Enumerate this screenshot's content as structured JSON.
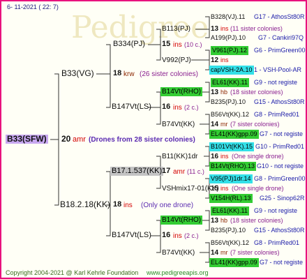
{
  "header": {
    "date_text": "6- 11-2021 ( 22: 7)"
  },
  "footer": {
    "copyright": "Copyright 2004-2021 @ Karl Kehrle Foundation",
    "site": "www.pedigreeapis.org"
  },
  "tree": {
    "root": {
      "label": "B33(SFW)",
      "gen_num": "20",
      "gen_code": "amr",
      "note": "(Drones from 28 sister colonies)"
    },
    "a": {
      "label": "B33(VG)",
      "gen_num": "18",
      "gen_code": "krw",
      "note": "(26 sister colonies)"
    },
    "a1": {
      "label": "B334(PJ)",
      "gen_num": "15",
      "gen_code": "ins",
      "note": "(10 c.)"
    },
    "a1a": {
      "label": "B113(PJ)",
      "gen_num": "13",
      "gen_code": "ins",
      "note": "(11 sister colonies)"
    },
    "a1a_f": {
      "label": "B328(VJ).11",
      "extra": "G17 - AthosSt80R"
    },
    "a1a_m": {
      "label": "A199(PJ).10",
      "extra": "G7 - Cankiri97Q"
    },
    "a1b": {
      "label": "V992(PJ)",
      "gen_num": "12",
      "gen_code": "ins"
    },
    "a1b_f": {
      "label": "V961(PJ).12",
      "extra": "G6 - PrimGreen00"
    },
    "a1b_m": {
      "label": "capVSH-2A.10",
      "extra": "1 - VSH-Pool-AR"
    },
    "a2": {
      "label": "B147Vt(LS)",
      "gen_num": "16",
      "gen_code": "ins",
      "note": "(2 c.)"
    },
    "a2a": {
      "label": "B14Vt(RHO)",
      "gen_num": "13",
      "gen_code": "hb",
      "note": "(18 sister colonies)"
    },
    "a2a_f": {
      "label": "EL61(KK).11",
      "extra": "G9 - not registe"
    },
    "a2a_m": {
      "label": "B235(PJ).10",
      "extra": "G15 - AthosSt80R"
    },
    "a2b": {
      "label": "B74Vt(KK)",
      "gen_num": "14",
      "gen_code": "mr",
      "note": "(7 sister colonies)"
    },
    "a2b_f": {
      "label": "B56Vt(KK).12",
      "extra": "G8 - PrimRed01"
    },
    "a2b_m": {
      "label": "EL41(KK)gpp.09",
      "extra": "G7 - not registe"
    },
    "b": {
      "label": "B18.2.18(KK)",
      "gen_num": "18",
      "gen_code": "ins",
      "note": "(Only one drone)"
    },
    "b1": {
      "label": "B17.1.537(KK)",
      "gen_num": "17",
      "gen_code": "amr",
      "note": "(11 c.)"
    },
    "b1a": {
      "label": "B11(KK)1dr",
      "gen_num": "16",
      "gen_code": "ins",
      "note": "(One single drone)"
    },
    "b1a_f": {
      "label": "B101Vt(KK).15",
      "extra": "G10 - PrimRed01"
    },
    "b1a_m": {
      "label": "B14Vt(RHO).13",
      "extra": "G10 - not registe"
    },
    "b1b": {
      "label": "VSHmix17-01(KK)",
      "gen_num": "15",
      "gen_code": "ins",
      "note": "(One single drone)"
    },
    "b1b_f": {
      "label": "V95(PJ)1dr.14",
      "extra": "G8 - PrimGreen00"
    },
    "b1b_m": {
      "label": "V154H(RL).13",
      "extra": "G25 - Sinop62R"
    },
    "b2": {
      "label": "B147Vt(LS)",
      "gen_num": "16",
      "gen_code": "ins",
      "note": "(2 c.)"
    },
    "b2a": {
      "label": "B14Vt(RHO)",
      "gen_num": "13",
      "gen_code": "hb",
      "note": "(18 sister colonies)"
    },
    "b2a_f": {
      "label": "EL61(KK).11",
      "extra": "G9 - not registe"
    },
    "b2a_m": {
      "label": "B235(PJ).10",
      "extra": "G15 - AthosSt80R"
    },
    "b2b": {
      "label": "B74Vt(KK)",
      "gen_num": "14",
      "gen_code": "mr",
      "note": "(7 sister colonies)"
    },
    "b2b_f": {
      "label": "B56Vt(KK).12",
      "extra": "G8 - PrimRed01"
    },
    "b2b_m": {
      "label": "EL41(KK)gpp.09",
      "extra": "G7 - not registe"
    }
  }
}
